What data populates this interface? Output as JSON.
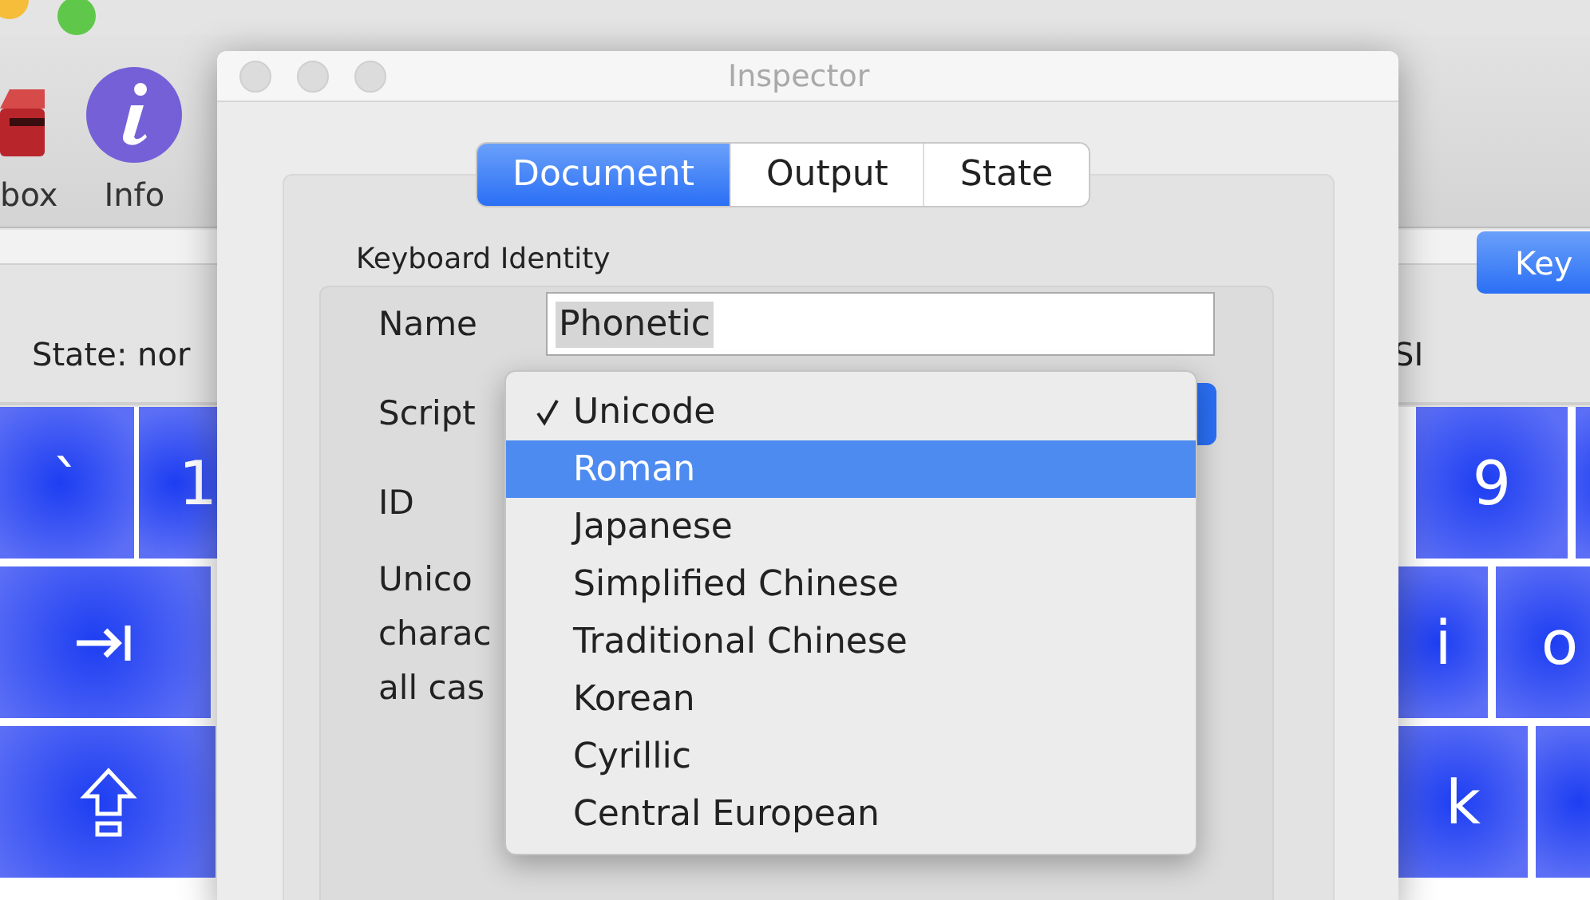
{
  "main_window": {
    "toolbar": [
      {
        "kind": "toolbox",
        "label": "box"
      },
      {
        "kind": "info",
        "label": "Info"
      }
    ],
    "key_button": "Key",
    "status_left": "State: nor",
    "status_right": "SI",
    "keys": [
      {
        "kind": "char",
        "label": "`"
      },
      {
        "kind": "char",
        "label": "1"
      },
      {
        "kind": "char",
        "label": "9"
      },
      {
        "kind": "blank"
      },
      {
        "kind": "tab"
      },
      {
        "kind": "char",
        "label": "i"
      },
      {
        "kind": "char",
        "label": "o"
      },
      {
        "kind": "shift"
      },
      {
        "kind": "char",
        "label": "k"
      },
      {
        "kind": "blank"
      }
    ]
  },
  "inspector": {
    "title": "Inspector",
    "tabs": [
      {
        "label": "Document",
        "selected": true
      },
      {
        "label": "Output",
        "selected": false
      },
      {
        "label": "State",
        "selected": false
      }
    ],
    "section_title": "Keyboard Identity",
    "name_label": "Name",
    "name_value": "Phonetic",
    "script_label": "Script",
    "id_label": "ID",
    "description": [
      "Unico",
      "charac",
      "all cas"
    ]
  },
  "script_menu": [
    {
      "label": "Unicode",
      "checked": true,
      "selected": false
    },
    {
      "label": "Roman",
      "checked": false,
      "selected": true
    },
    {
      "label": "Japanese",
      "checked": false,
      "selected": false
    },
    {
      "label": "Simplified Chinese",
      "checked": false,
      "selected": false
    },
    {
      "label": "Traditional Chinese",
      "checked": false,
      "selected": false
    },
    {
      "label": "Korean",
      "checked": false,
      "selected": false
    },
    {
      "label": "Cyrillic",
      "checked": false,
      "selected": false
    },
    {
      "label": "Central European",
      "checked": false,
      "selected": false
    }
  ]
}
